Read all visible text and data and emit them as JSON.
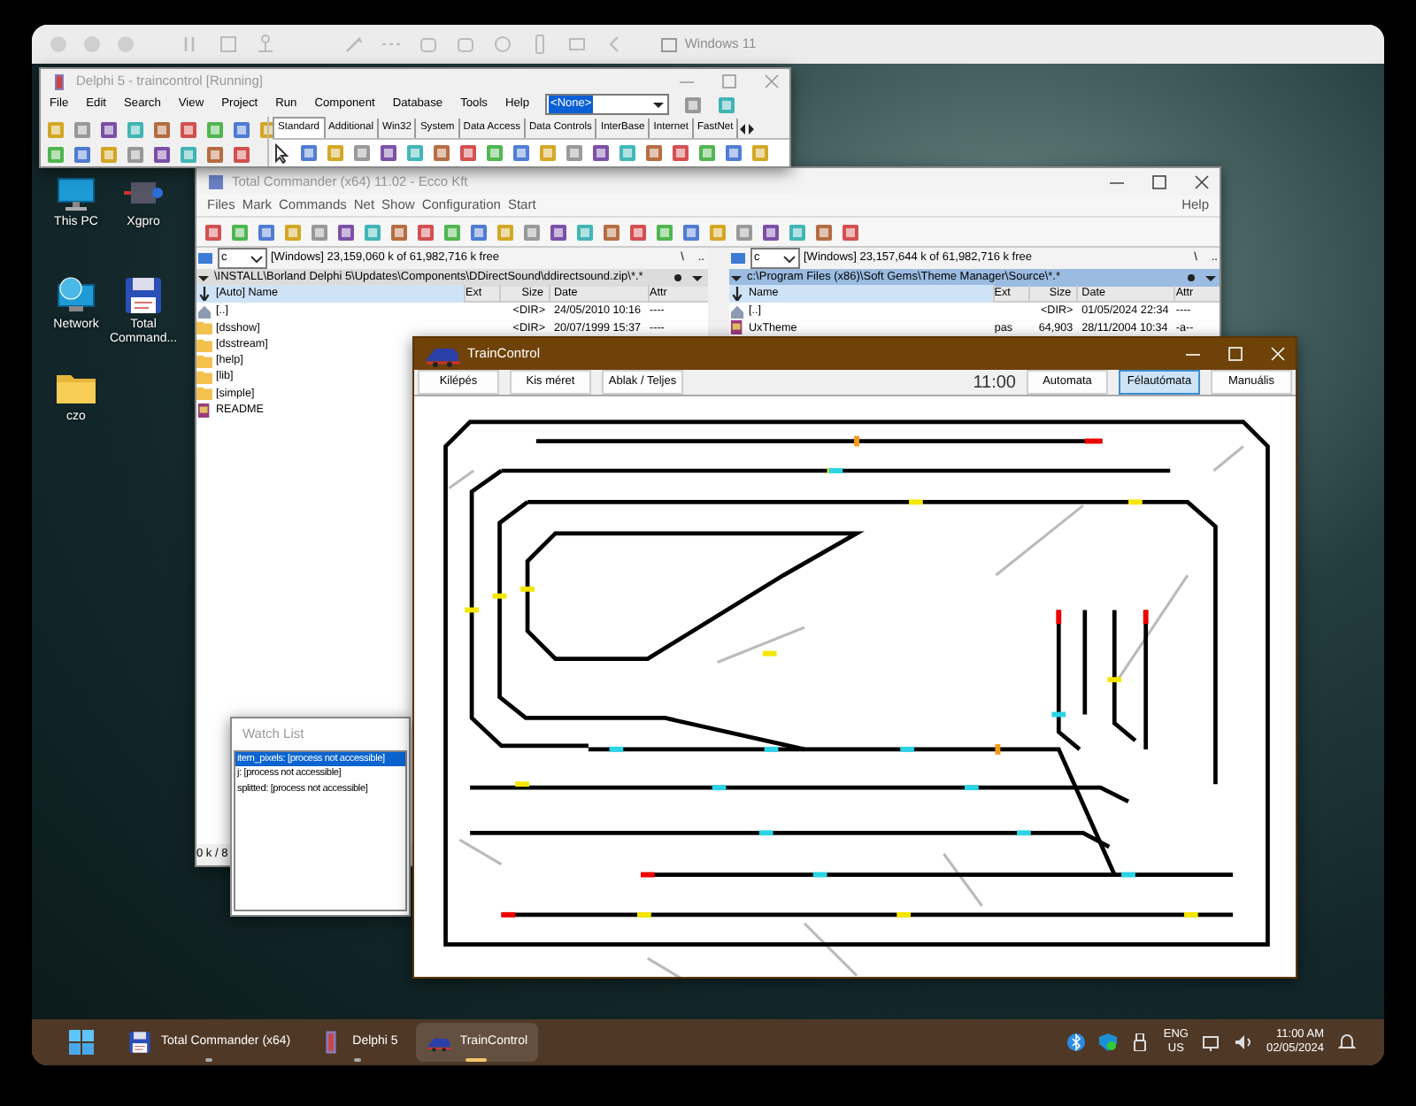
{
  "vm_window": {
    "title": "Windows 11"
  },
  "desktop_icons": [
    {
      "kind": "pc",
      "label": "This PC"
    },
    {
      "kind": "chip",
      "label": "Xgpro"
    },
    {
      "kind": "network",
      "label": "Network"
    },
    {
      "kind": "floppy",
      "label": "Total Command..."
    },
    {
      "kind": "folder",
      "label": "czo"
    }
  ],
  "delphi": {
    "title": "Delphi 5 - traincontrol [Running]",
    "menu": [
      "File",
      "Edit",
      "Search",
      "View",
      "Project",
      "Run",
      "Component",
      "Database",
      "Tools",
      "Help"
    ],
    "combo": "<None>",
    "palette_tabs": [
      {
        "label": "Standard",
        "selected": true
      },
      {
        "label": "Additional",
        "selected": false
      },
      {
        "label": "Win32",
        "selected": false
      },
      {
        "label": "System",
        "selected": false
      },
      {
        "label": "Data Access",
        "selected": false
      },
      {
        "label": "Data Controls",
        "selected": false
      },
      {
        "label": "InterBase",
        "selected": false
      },
      {
        "label": "Internet",
        "selected": false
      },
      {
        "label": "FastNet",
        "selected": false
      }
    ]
  },
  "total_commander": {
    "title": "Total Commander (x64) 11.02 - Ecco Kft",
    "menu": [
      "Files",
      "Mark",
      "Commands",
      "Net",
      "Show",
      "Configuration",
      "Start"
    ],
    "help": "Help",
    "panels": [
      {
        "active": false,
        "drive": "c",
        "free": "[Windows]  23,159,060 k of 61,982,716 k free",
        "root": "\\",
        "up": "..",
        "path": "\\INSTALL\\Borland Delphi 5\\Updates\\Components\\DDirectSound\\ddirectsound.zip\\*.*",
        "columns": [
          "[Auto] Name",
          "Ext",
          "Size",
          "Date",
          "Attr"
        ],
        "rows": [
          {
            "kind": "up",
            "name": "[..]",
            "ext": "",
            "size": "<DIR>",
            "date": "24/05/2010 10:16",
            "attr": "----"
          },
          {
            "kind": "folder",
            "name": "[dsshow]",
            "ext": "",
            "size": "<DIR>",
            "date": "20/07/1999 15:37",
            "attr": "----"
          },
          {
            "kind": "folder",
            "name": "[dsstream]",
            "ext": "",
            "size": "",
            "date": "",
            "attr": ""
          },
          {
            "kind": "folder",
            "name": "[help]",
            "ext": "",
            "size": "",
            "date": "",
            "attr": ""
          },
          {
            "kind": "folder",
            "name": "[lib]",
            "ext": "",
            "size": "",
            "date": "",
            "attr": ""
          },
          {
            "kind": "folder",
            "name": "[simple]",
            "ext": "",
            "size": "",
            "date": "",
            "attr": ""
          },
          {
            "kind": "file",
            "name": "README",
            "ext": "",
            "size": "",
            "date": "",
            "attr": ""
          }
        ]
      },
      {
        "active": true,
        "drive": "c",
        "free": "[Windows]  23,157,644 k of 61,982,716 k free",
        "root": "\\",
        "up": "..",
        "path": "c:\\Program Files (x86)\\Soft Gems\\Theme Manager\\Source\\*.*",
        "columns": [
          "Name",
          "Ext",
          "Size",
          "Date",
          "Attr"
        ],
        "rows": [
          {
            "kind": "up",
            "name": "[..]",
            "ext": "",
            "size": "<DIR>",
            "date": "01/05/2024 22:34",
            "attr": "----"
          },
          {
            "kind": "file",
            "name": "UxTheme",
            "ext": "pas",
            "size": "64,903",
            "date": "28/11/2004 10:34",
            "attr": "-a--"
          }
        ]
      }
    ],
    "status": "0 k / 8"
  },
  "watch_list": {
    "title": "Watch List",
    "items": [
      {
        "text": "item_pixels: [process not accessible]",
        "selected": true
      },
      {
        "text": "j: [process not accessible]",
        "selected": false
      },
      {
        "text": "splitted: [process not accessible]",
        "selected": false
      }
    ]
  },
  "train_control": {
    "title": "TrainControl",
    "buttons": [
      "Kilépés",
      "Kis méret",
      "Ablak / Teljes"
    ],
    "time": "11:00",
    "modes": [
      {
        "label": "Automata",
        "selected": false
      },
      {
        "label": "Félautómata",
        "selected": true
      },
      {
        "label": "Manuális",
        "selected": false
      }
    ]
  },
  "taskbar": {
    "apps": [
      {
        "kind": "floppy",
        "label": "Total Commander (x64)",
        "selected": false
      },
      {
        "kind": "delphi",
        "label": "Delphi 5",
        "selected": false
      },
      {
        "kind": "train",
        "label": "TrainControl",
        "selected": true
      }
    ],
    "language": "ENG",
    "region": "US",
    "time": "11:00 AM",
    "date": "02/05/2024"
  }
}
